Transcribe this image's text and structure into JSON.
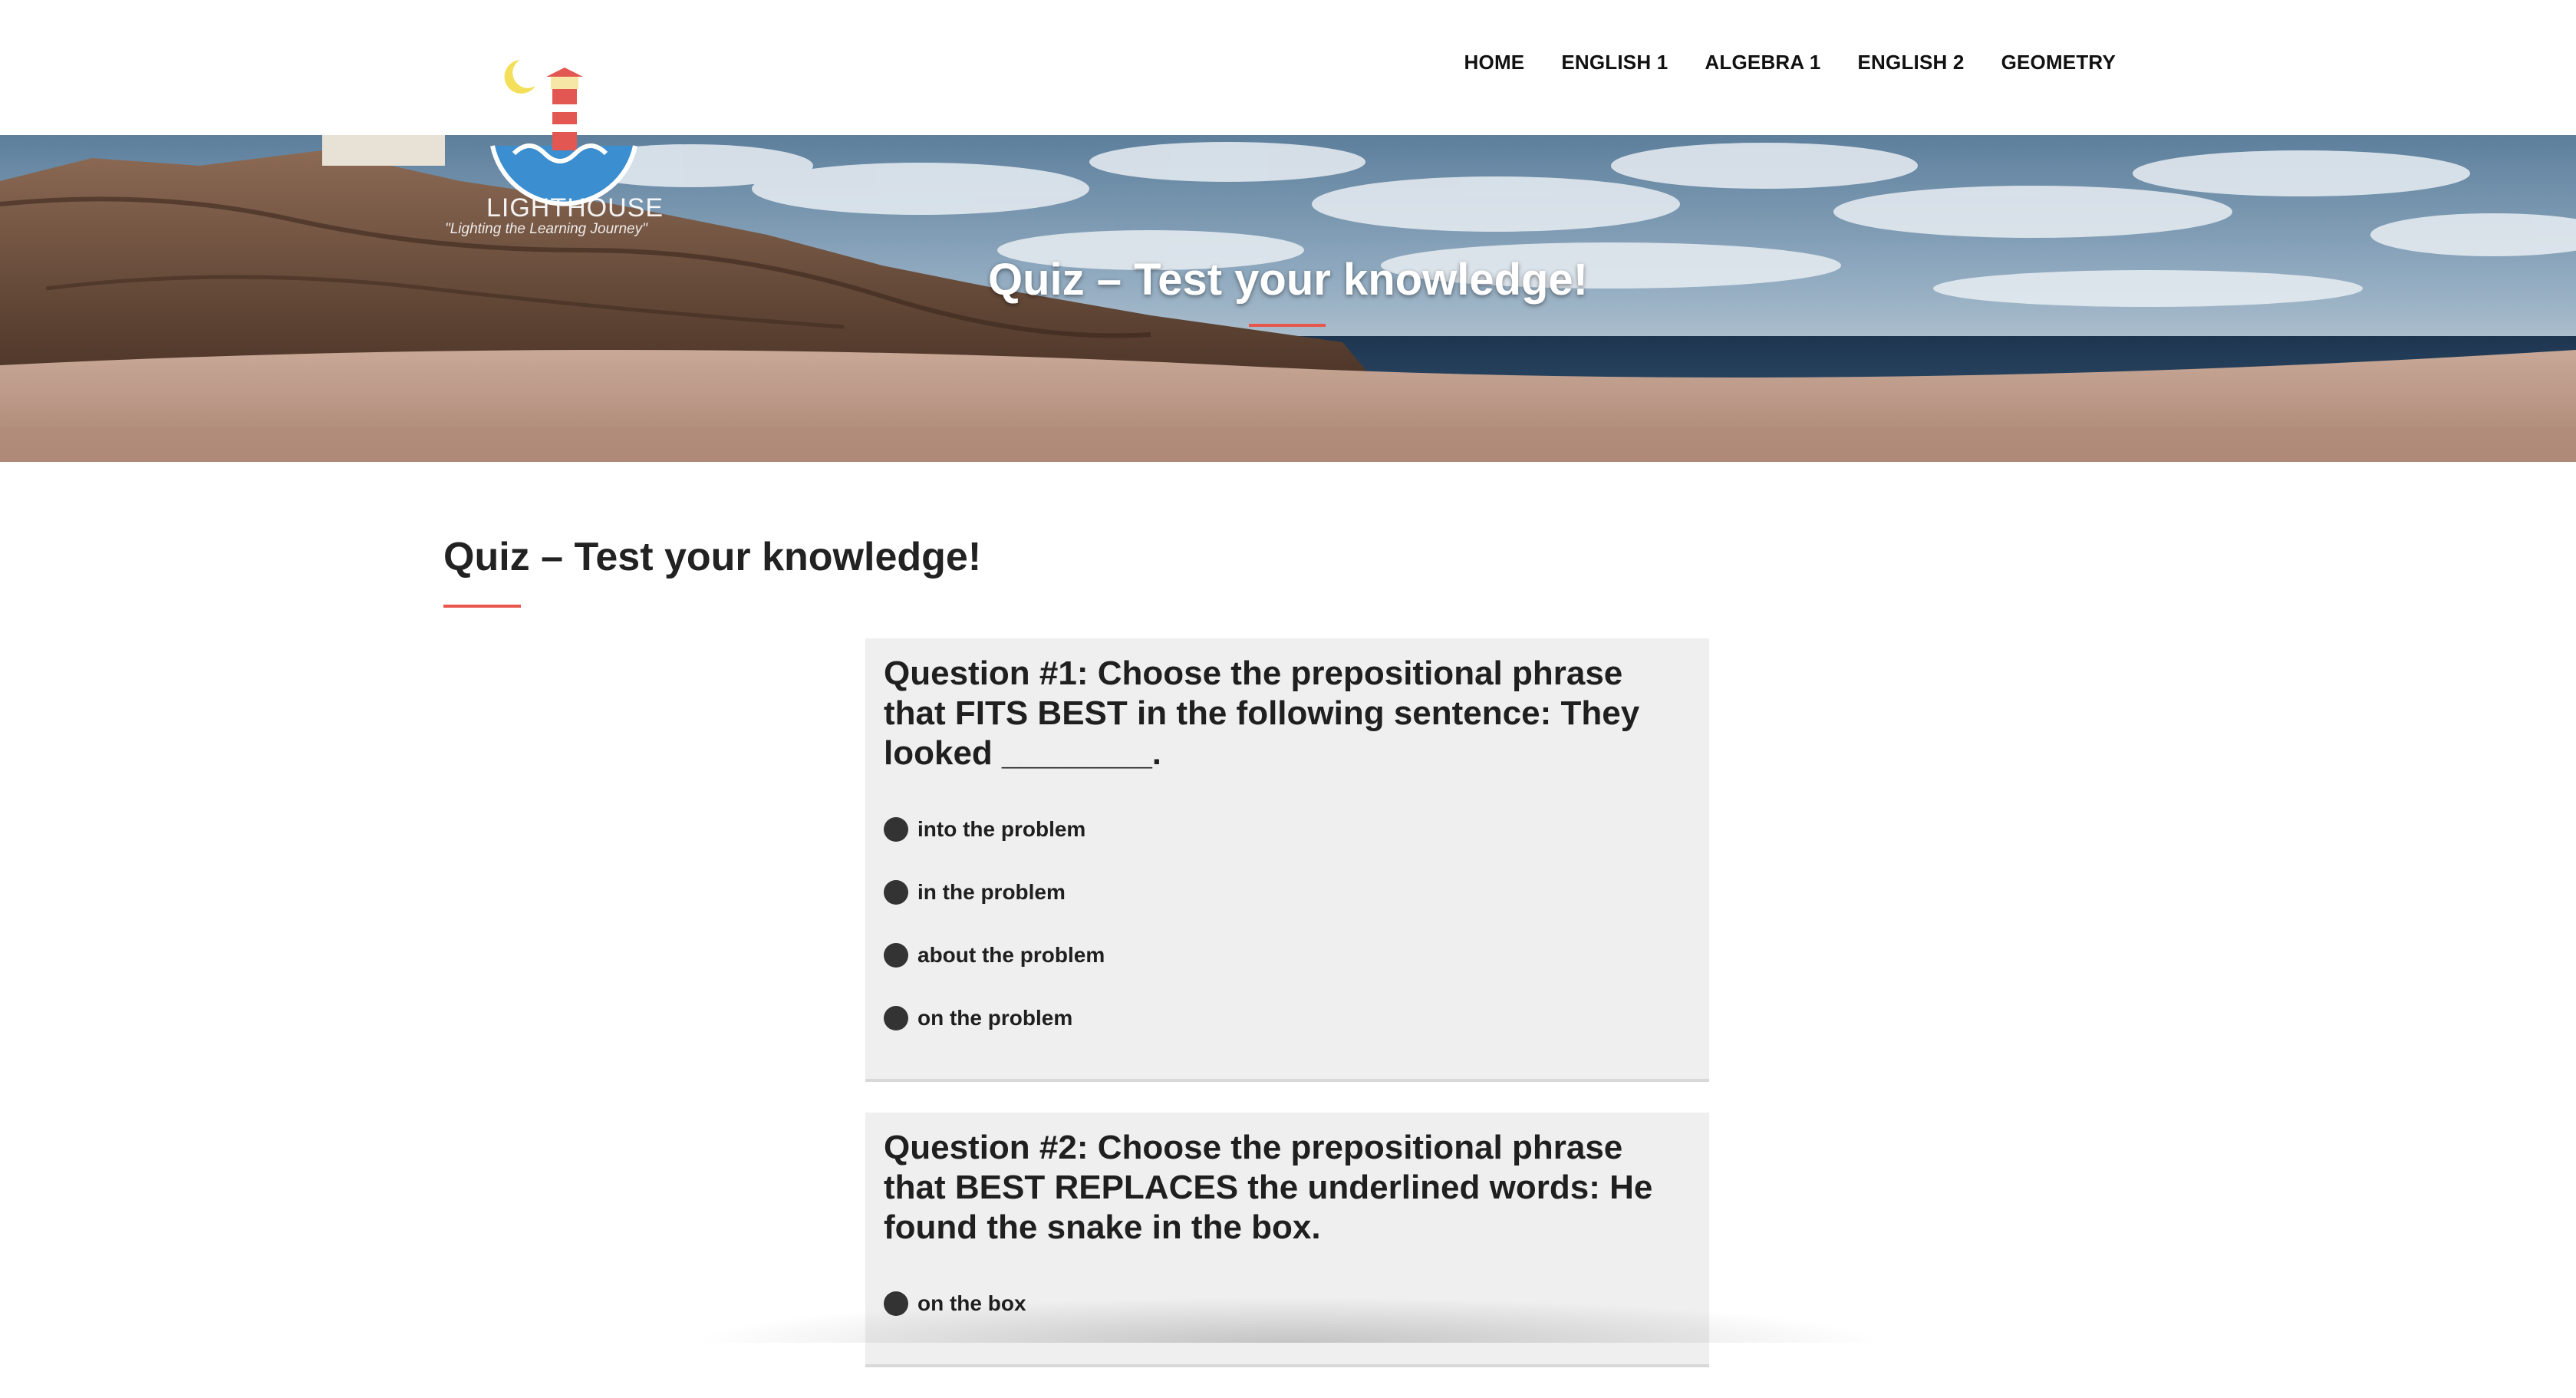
{
  "nav": {
    "items": [
      "HOME",
      "ENGLISH 1",
      "ALGEBRA 1",
      "ENGLISH 2",
      "GEOMETRY"
    ]
  },
  "logo": {
    "name": "LIGHTHOUSE",
    "tagline": "\"Lighting the Learning Journey\"",
    "icon": "lighthouse-icon"
  },
  "hero": {
    "title": "Quiz – Test your knowledge!"
  },
  "page": {
    "title": "Quiz – Test your knowledge!"
  },
  "questions": [
    {
      "text": "Question #1: Choose the prepositional phrase that FITS BEST in the following sentence: They looked ________.",
      "options": [
        "into the problem",
        "in the problem",
        "about the problem",
        "on the problem"
      ]
    },
    {
      "text": "Question #2: Choose the prepositional phrase that BEST REPLACES the underlined words: He found the snake in the box.",
      "options": [
        "on the box"
      ]
    }
  ],
  "colors": {
    "accent": "#e8574c",
    "question_bg": "#efefef",
    "radio": "#333333"
  }
}
